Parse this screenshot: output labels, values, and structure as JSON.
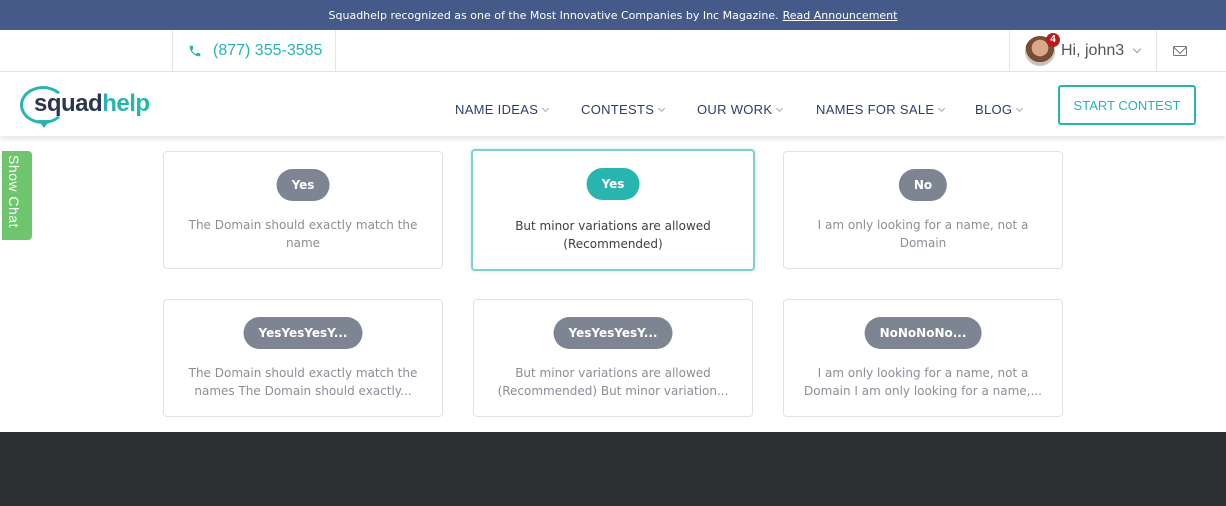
{
  "announcement": {
    "text": "Squadhelp recognized as one of the Most Innovative Companies by Inc Magazine.",
    "link": "Read Announcement"
  },
  "contact": {
    "phone": "(877) 355-3585",
    "greeting": "Hi, john3",
    "notification_count": "4"
  },
  "logo": {
    "part1": "squad",
    "part2": "help"
  },
  "nav": {
    "items": [
      {
        "label": "NAME IDEAS"
      },
      {
        "label": "CONTESTS"
      },
      {
        "label": "OUR WORK"
      },
      {
        "label": "NAMES FOR SALE"
      },
      {
        "label": "BLOG"
      }
    ],
    "cta": "START CONTEST"
  },
  "chat": {
    "label": "Show Chat"
  },
  "options": [
    {
      "badge": "Yes",
      "text": "The Domain should exactly match the name",
      "selected": false
    },
    {
      "badge": "Yes",
      "text": "But minor variations are allowed (Recommended)",
      "selected": true
    },
    {
      "badge": "No",
      "text": "I am only looking for a name, not a Domain",
      "selected": false
    },
    {
      "badge": "YesYesYesY...",
      "text": "The Domain should exactly match the names The Domain should exactly...",
      "selected": false
    },
    {
      "badge": "YesYesYesY...",
      "text": "But minor variations are allowed (Recommended) But minor variation...",
      "selected": false
    },
    {
      "badge": "NoNoNoNo...",
      "text": "I am only looking for a name, not a Domain I am only looking for a name,...",
      "selected": false
    }
  ],
  "colors": {
    "accent": "#28b5b0",
    "banner": "#465a8a",
    "nav_text": "#2a3f6b",
    "chat": "#6ec56e",
    "footer": "#2c3032"
  },
  "icons": {
    "phone": "phone-icon",
    "mail": "mail-icon",
    "avatar": "avatar",
    "chevron": "chevron-down-icon"
  }
}
